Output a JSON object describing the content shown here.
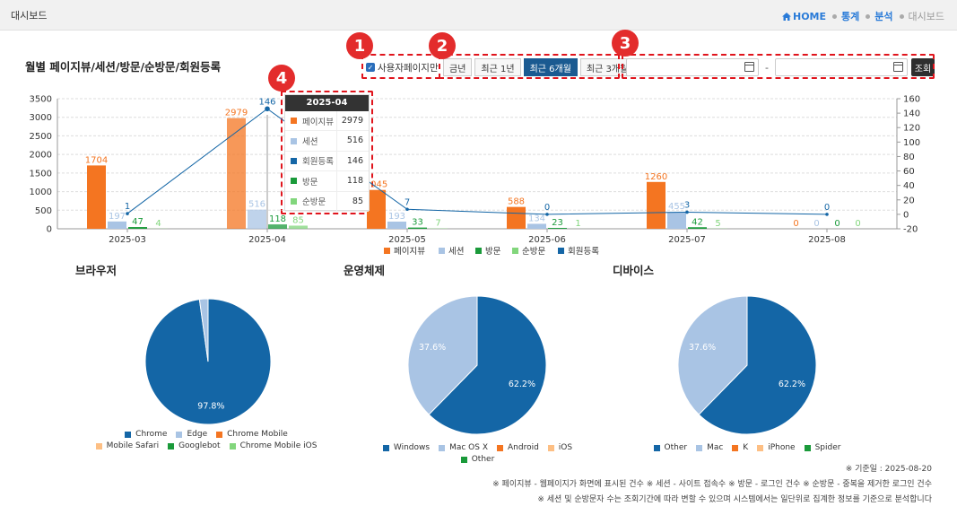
{
  "app": {
    "title": "대시보드"
  },
  "breadcrumb": {
    "home": "HOME",
    "items": [
      "통계",
      "분석",
      "대시보드"
    ]
  },
  "section": {
    "title": "월별 페이지뷰/세션/방문/순방문/회원등록"
  },
  "filters": {
    "checkbox_label": "사용자페이지만",
    "checkbox_checked": true,
    "periods": [
      "금년",
      "최근 1년",
      "최근 6개월",
      "최근 3개월"
    ],
    "active_period": "최근 6개월",
    "start_date": "",
    "end_date": "",
    "date_separator": "-",
    "search_label": "조회"
  },
  "badges": [
    "1",
    "2",
    "3",
    "4"
  ],
  "tooltip": {
    "title": "2025-04",
    "rows": [
      {
        "label": "페이지뷰",
        "value": "2979",
        "color": "#f47521"
      },
      {
        "label": "세션",
        "value": "516",
        "color": "#a9c4e4"
      },
      {
        "label": "회원등록",
        "value": "146",
        "color": "#1466a6"
      },
      {
        "label": "방문",
        "value": "118",
        "color": "#1a9a3a"
      },
      {
        "label": "순방문",
        "value": "85",
        "color": "#82d67c"
      }
    ]
  },
  "chart_data": {
    "type": "bar",
    "categories": [
      "2025-03",
      "2025-04",
      "2025-05",
      "2025-06",
      "2025-07",
      "2025-08"
    ],
    "series": [
      {
        "name": "페이지뷰",
        "type": "bar",
        "axis": "left",
        "color": "#f47521",
        "values": [
          1704,
          2979,
          1045,
          588,
          1260,
          0
        ]
      },
      {
        "name": "세션",
        "type": "bar",
        "axis": "left",
        "color": "#a9c4e4",
        "values": [
          197,
          516,
          193,
          134,
          455,
          0
        ]
      },
      {
        "name": "방문",
        "type": "bar",
        "axis": "left",
        "color": "#1a9a3a",
        "values": [
          47,
          118,
          33,
          23,
          42,
          0
        ]
      },
      {
        "name": "순방문",
        "type": "bar",
        "axis": "left",
        "color": "#82d67c",
        "values": [
          4,
          85,
          7,
          1,
          5,
          0
        ]
      },
      {
        "name": "회원등록",
        "type": "line",
        "axis": "right",
        "color": "#1466a6",
        "values": [
          1,
          146,
          7,
          0,
          3,
          0
        ]
      }
    ],
    "y_left": {
      "min": 0,
      "max": 3500,
      "ticks": [
        "0",
        "500",
        "1000",
        "1500",
        "2000",
        "2500",
        "3000",
        "3500"
      ]
    },
    "y_right": {
      "min": -20,
      "max": 160,
      "ticks": [
        "-20",
        "0",
        "20",
        "40",
        "60",
        "80",
        "100",
        "120",
        "140",
        "160"
      ]
    },
    "grid": true,
    "legend": "bottom"
  },
  "pies": [
    {
      "title": "브라우저",
      "type": "pie",
      "slices": [
        {
          "label": "Chrome",
          "value": 97.8,
          "color": "#1466a6"
        },
        {
          "label": "Edge",
          "value": 2.2,
          "color": "#a9c4e4"
        },
        {
          "label": "Chrome Mobile",
          "value": 0,
          "color": "#f47521"
        },
        {
          "label": "Mobile Safari",
          "value": 0,
          "color": "#fdbf84"
        },
        {
          "label": "Googlebot",
          "value": 0,
          "color": "#1a9a3a"
        },
        {
          "label": "Chrome Mobile iOS",
          "value": 0,
          "color": "#82d67c"
        }
      ],
      "shown_labels": [
        "97.8%"
      ]
    },
    {
      "title": "운영체제",
      "type": "pie",
      "slices": [
        {
          "label": "Windows",
          "value": 62.2,
          "color": "#1466a6"
        },
        {
          "label": "Mac OS X",
          "value": 37.6,
          "color": "#a9c4e4"
        },
        {
          "label": "Android",
          "value": 0,
          "color": "#f47521"
        },
        {
          "label": "iOS",
          "value": 0,
          "color": "#fdbf84"
        },
        {
          "label": "Other",
          "value": 0,
          "color": "#1a9a3a"
        }
      ],
      "shown_labels": [
        "62.2%",
        "37.6%"
      ]
    },
    {
      "title": "디바이스",
      "type": "pie",
      "slices": [
        {
          "label": "Other",
          "value": 62.2,
          "color": "#1466a6"
        },
        {
          "label": "Mac",
          "value": 37.6,
          "color": "#a9c4e4"
        },
        {
          "label": "K",
          "value": 0,
          "color": "#f47521"
        },
        {
          "label": "iPhone",
          "value": 0,
          "color": "#fdbf84"
        },
        {
          "label": "Spider",
          "value": 0,
          "color": "#1a9a3a"
        }
      ],
      "shown_labels": [
        "62.2%",
        "37.6%"
      ]
    }
  ],
  "notes": [
    "※ 기준일 : 2025-08-20",
    "※ 페이지뷰 - 웹페이지가 화면에 표시된 건수   ※ 세션 - 사이트 접속수   ※ 방문 - 로그인 건수   ※ 순방문 - 중복을 제거한 로그인 건수",
    "※ 세션 및 순방문자 수는 조회기간에 따라 변할 수 있으며 시스템에서는 일단위로 집계한 정보를 기준으로 분석합니다"
  ]
}
